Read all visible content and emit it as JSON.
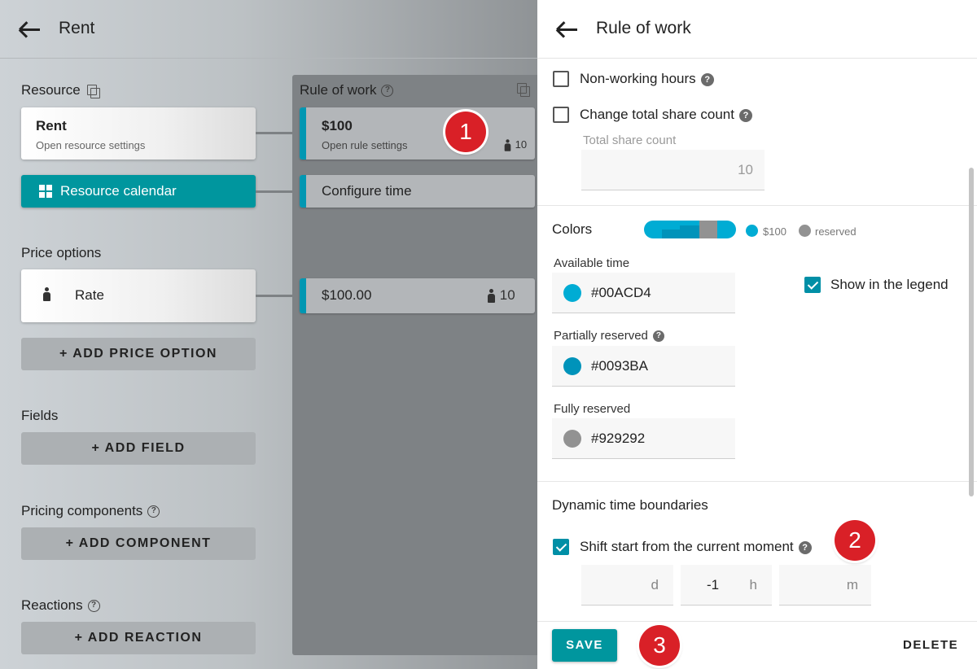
{
  "left": {
    "title": "Rent",
    "resource_label": "Resource",
    "resource_card": {
      "title": "Rent",
      "subtitle": "Open resource settings"
    },
    "calendar_button": "Resource calendar",
    "price_options_label": "Price options",
    "rate_card": "Rate",
    "add_price_option": "+ ADD PRICE OPTION",
    "fields_label": "Fields",
    "add_field": "+ ADD FIELD",
    "pricing_components_label": "Pricing components",
    "add_component": "+ ADD COMPONENT",
    "reactions_label": "Reactions",
    "add_reaction": "+ ADD REACTION"
  },
  "rule_column": {
    "label": "Rule of work",
    "rule_card": {
      "title": "$100",
      "subtitle": "Open rule settings",
      "count": "10"
    },
    "configure_time": "Configure time",
    "price_card": {
      "price": "$100.00",
      "count": "10"
    }
  },
  "badges": [
    "1",
    "2",
    "3"
  ],
  "panel": {
    "title": "Rule of work",
    "non_working_hours": {
      "label": "Non-working hours",
      "checked": false
    },
    "change_total_share": {
      "label": "Change total share count",
      "checked": false
    },
    "total_share_count": {
      "label": "Total share count",
      "value": "10"
    },
    "colors": {
      "label": "Colors",
      "legend": [
        {
          "name": "$100",
          "color": "#00ACD4"
        },
        {
          "name": "reserved",
          "color": "#929292"
        }
      ],
      "available_time": {
        "label": "Available time",
        "value": "#00ACD4"
      },
      "partially_reserved": {
        "label": "Partially reserved",
        "value": "#0093BA"
      },
      "fully_reserved": {
        "label": "Fully reserved",
        "value": "#929292"
      },
      "show_in_legend": {
        "label": "Show in the legend",
        "checked": true
      }
    },
    "dynamic": {
      "label": "Dynamic time boundaries",
      "shift_start": {
        "label": "Shift start from the current moment",
        "checked": true
      },
      "days": {
        "value": "",
        "unit": "d"
      },
      "hours": {
        "value": "-1",
        "unit": "h"
      },
      "minutes": {
        "value": "",
        "unit": "m"
      }
    },
    "save": "SAVE",
    "delete": "DELETE"
  }
}
